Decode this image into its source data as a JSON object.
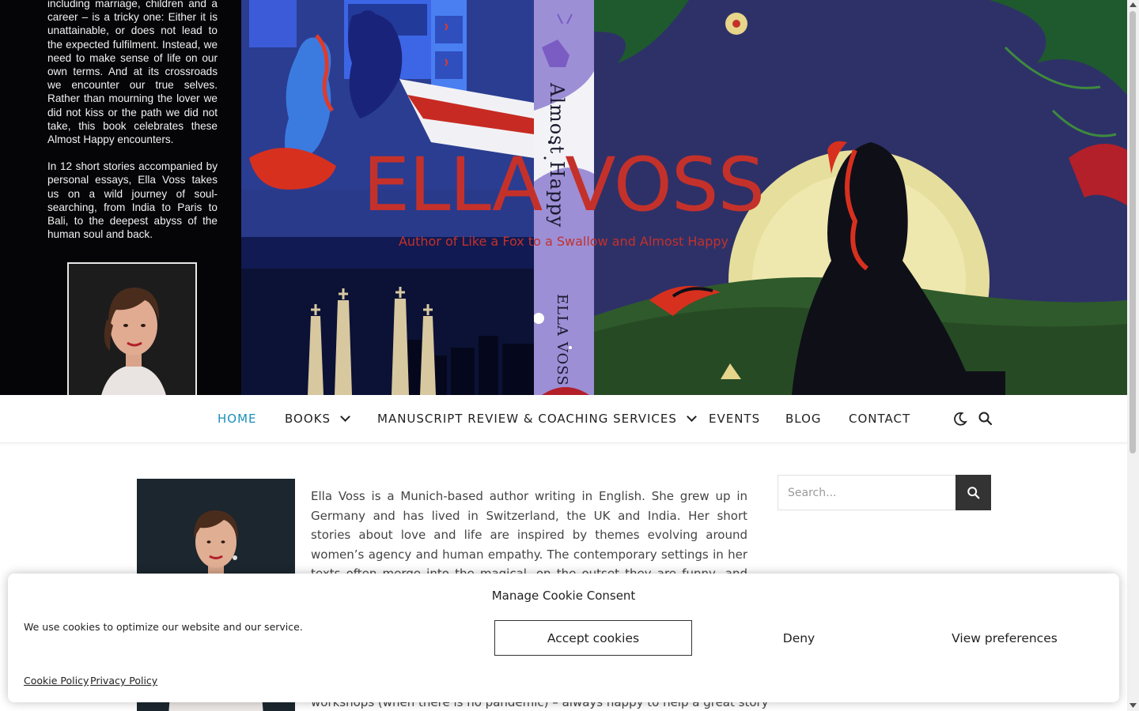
{
  "hero": {
    "blurb_paragraphs": [
      "including marriage, children and a career – is a tricky one: Either it is unattainable, or does not lead to the expected fulfilment. Instead, we need to make sense of life on our own terms. And at its crossroads we encounter our true selves. Rather than mourning the lover we did not kiss or the path we did not take, this book celebrates these Almost Happy encounters.",
      "In 12 short stories accompanied by personal essays, Ella Voss takes us on a wild journey of soul-searching, from India to Paris to Bali, to the deepest abyss of the human soul and back."
    ],
    "spine_title": "Almost Happy",
    "spine_author": "ELLA VOSS",
    "site_title": "ELLA VOSS",
    "tagline": "Author of Like a Fox to a Swallow and Almost Happy"
  },
  "nav": {
    "items": [
      {
        "label": "HOME",
        "active": true
      },
      {
        "label": "BOOKS",
        "dropdown": true
      },
      {
        "label": "MANUSCRIPT REVIEW & COACHING SERVICES",
        "dropdown": true
      },
      {
        "label": "EVENTS"
      },
      {
        "label": "BLOG"
      },
      {
        "label": "CONTACT"
      }
    ],
    "dark_mode_icon": "moon-icon",
    "search_icon": "search-icon",
    "active_color": "#1b8fba"
  },
  "content": {
    "intro": "Ella Voss is a Munich-based author writing in English. She grew up in Germany and has lived in Switzerland, the UK and India. Her short stories about love and life are inspired by themes evolving around women’s agency and human empathy. The contemporary settings in her texts often merge into the magical, on the outset they are funny, and then slowly creep under your skin.",
    "continued": "workshops (when there is no pandemic) – always happy to help a great story"
  },
  "sidebar": {
    "search_placeholder": "Search...",
    "search_button_icon": "search-icon"
  },
  "cookie": {
    "title": "Manage Cookie Consent",
    "message": "We use cookies to optimize our website and our service.",
    "accept_label": "Accept cookies",
    "deny_label": "Deny",
    "preferences_label": "View preferences",
    "cookie_policy_label": "Cookie Policy",
    "privacy_policy_label": "Privacy Policy"
  },
  "colors": {
    "brand_red": "#c4312b",
    "nav_active": "#1b8fba",
    "search_button_bg": "#333333"
  }
}
